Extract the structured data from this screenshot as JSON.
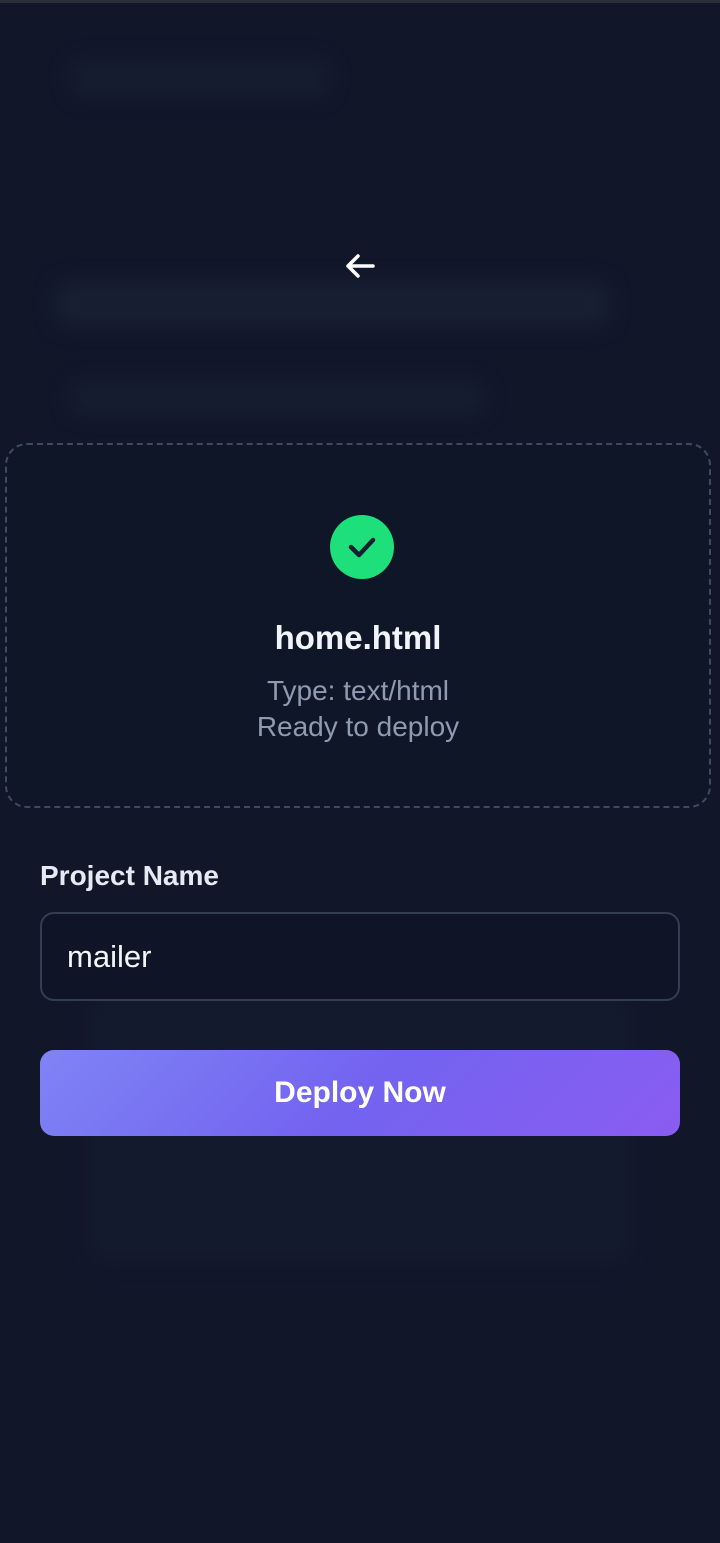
{
  "nav": {
    "back_icon": "arrow-left-icon"
  },
  "file": {
    "status_icon": "check-circle-icon",
    "name": "home.html",
    "type_text": "Type: text/html",
    "status_text": "Ready to deploy"
  },
  "form": {
    "project_label": "Project Name",
    "project_value": "mailer",
    "deploy_label": "Deploy Now"
  },
  "colors": {
    "background": "#111729",
    "success": "#1ee07a",
    "accent_start": "#7f84f5",
    "accent_end": "#8a5cf2"
  }
}
